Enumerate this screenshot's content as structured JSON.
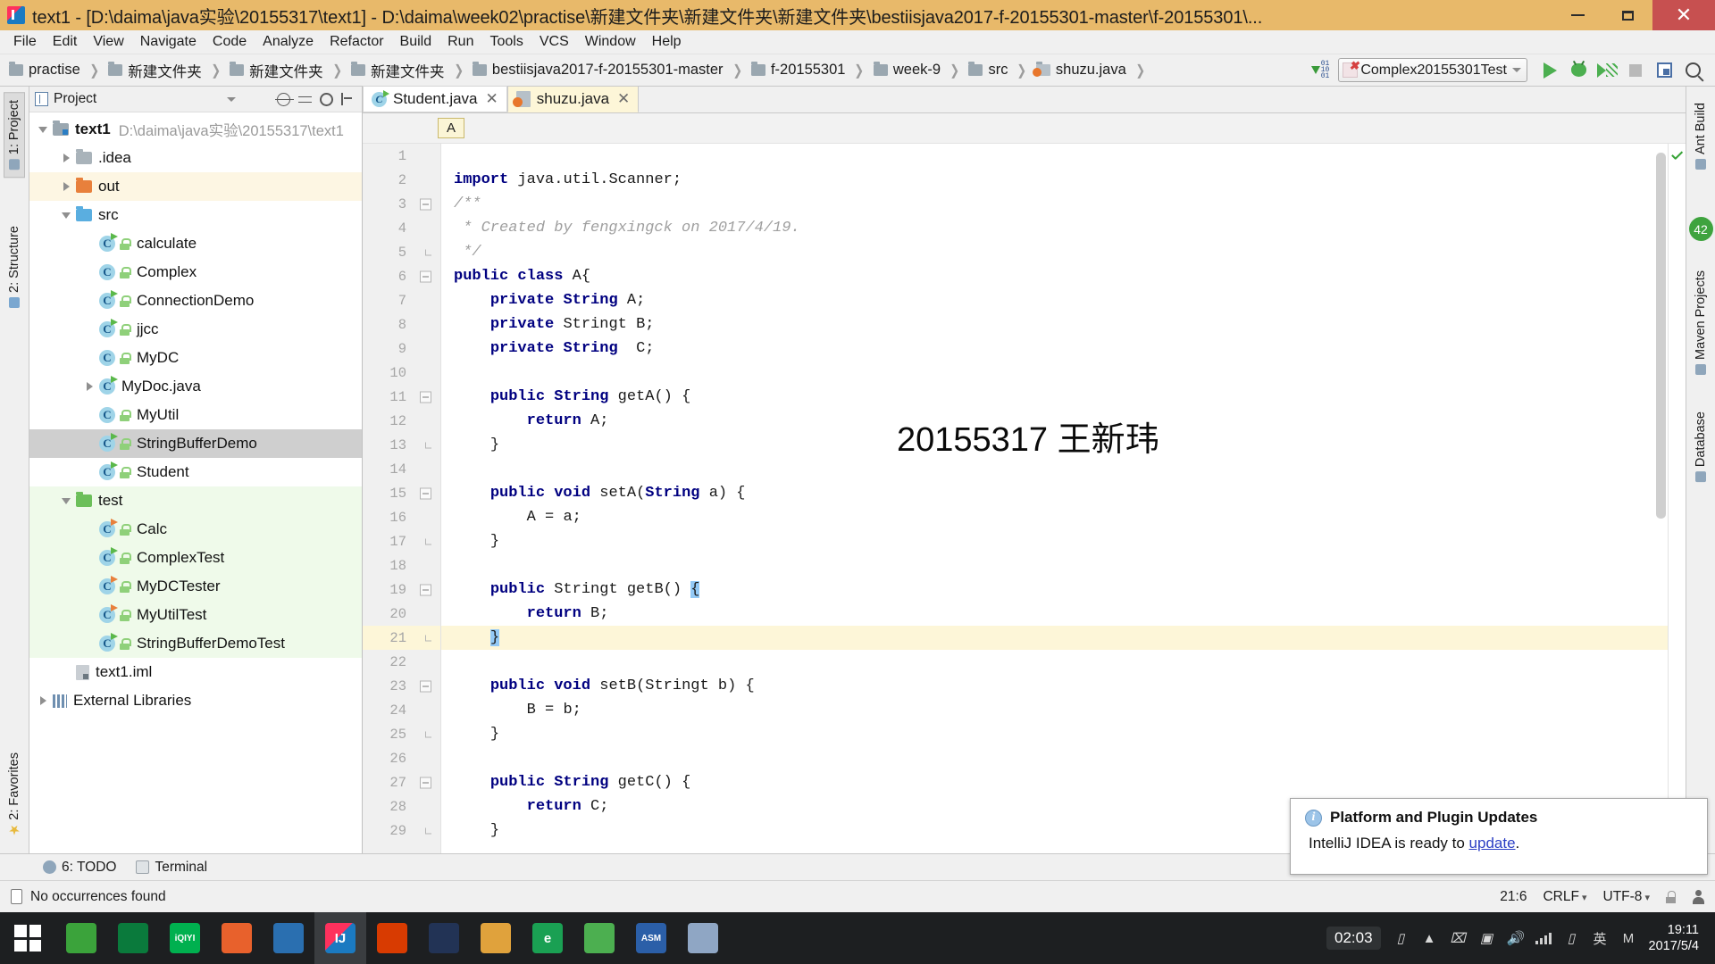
{
  "window": {
    "title": "text1 - [D:\\daima\\java实验\\20155317\\text1] - D:\\daima\\week02\\practise\\新建文件夹\\新建文件夹\\新建文件夹\\bestiisjava2017-f-20155301-master\\f-20155301\\...",
    "minimize_label": "Minimize",
    "maximize_label": "Maximize",
    "close_label": "✕"
  },
  "menu": [
    {
      "label": "File"
    },
    {
      "label": "Edit"
    },
    {
      "label": "View"
    },
    {
      "label": "Navigate"
    },
    {
      "label": "Code"
    },
    {
      "label": "Analyze"
    },
    {
      "label": "Refactor"
    },
    {
      "label": "Build"
    },
    {
      "label": "Run"
    },
    {
      "label": "Tools"
    },
    {
      "label": "VCS"
    },
    {
      "label": "Window"
    },
    {
      "label": "Help"
    }
  ],
  "navbar": {
    "breadcrumbs": [
      {
        "label": "practise",
        "kind": "folder"
      },
      {
        "label": "新建文件夹",
        "kind": "folder"
      },
      {
        "label": "新建文件夹",
        "kind": "folder"
      },
      {
        "label": "新建文件夹",
        "kind": "folder"
      },
      {
        "label": "bestiisjava2017-f-20155301-master",
        "kind": "folder"
      },
      {
        "label": "f-20155301",
        "kind": "folder"
      },
      {
        "label": "week-9",
        "kind": "folder"
      },
      {
        "label": "src",
        "kind": "folder"
      },
      {
        "label": "shuzu.java",
        "kind": "java"
      }
    ],
    "run_config": "Complex20155301Test",
    "buttons": [
      "run",
      "debug",
      "coverage",
      "stop",
      "layout",
      "search"
    ]
  },
  "left_strip": [
    {
      "label": "1: Project",
      "icon": "project-icon",
      "active": true
    },
    {
      "label": "2: Structure",
      "icon": "structure-icon",
      "active": false
    },
    {
      "label": "2: Favorites",
      "icon": "favorites-icon",
      "active": false
    }
  ],
  "right_strip": [
    {
      "label": "Ant Build",
      "icon": "ant-icon"
    },
    {
      "label": "Maven Projects",
      "icon": "maven-icon"
    },
    {
      "label": "Database",
      "icon": "database-icon"
    }
  ],
  "project": {
    "header_title": "Project",
    "actions": [
      "target-icon",
      "collapse-all-icon",
      "gear-icon",
      "hide-icon"
    ],
    "tree": [
      {
        "label": "text1",
        "path": "D:\\daima\\java实验\\20155317\\text1",
        "icon": "module-folder-icon",
        "indent": 0,
        "twisty": "down",
        "bold": true,
        "bg": "none"
      },
      {
        "label": ".idea",
        "icon": "folder-grey-icon",
        "indent": 1,
        "twisty": "right",
        "bg": "none"
      },
      {
        "label": "out",
        "icon": "folder-orange-icon",
        "indent": 1,
        "twisty": "right",
        "bg": "out"
      },
      {
        "label": "src",
        "icon": "folder-blue-icon",
        "indent": 1,
        "twisty": "down",
        "bg": "none"
      },
      {
        "label": "calculate",
        "icon": "class-runnable-icon",
        "indent": 2,
        "twisty": "none",
        "bg": "none"
      },
      {
        "label": "Complex",
        "icon": "class-icon",
        "indent": 2,
        "twisty": "none",
        "bg": "none"
      },
      {
        "label": "ConnectionDemo",
        "icon": "class-runnable-icon",
        "indent": 2,
        "twisty": "none",
        "bg": "none"
      },
      {
        "label": "jjcc",
        "icon": "class-runnable-icon",
        "indent": 2,
        "twisty": "none",
        "bg": "none"
      },
      {
        "label": "MyDC",
        "icon": "class-icon",
        "indent": 2,
        "twisty": "none",
        "bg": "none"
      },
      {
        "label": "MyDoc.java",
        "icon": "class-runnable-icon",
        "indent": 2,
        "twisty": "right",
        "bg": "none",
        "nolock": true
      },
      {
        "label": "MyUtil",
        "icon": "class-icon",
        "indent": 2,
        "twisty": "none",
        "bg": "none"
      },
      {
        "label": "StringBufferDemo",
        "icon": "class-runnable-icon",
        "indent": 2,
        "twisty": "none",
        "bg": "selected"
      },
      {
        "label": "Student",
        "icon": "class-runnable-icon",
        "indent": 2,
        "twisty": "none",
        "bg": "none"
      },
      {
        "label": "test",
        "icon": "folder-green-icon",
        "indent": 1,
        "twisty": "down",
        "bg": "test"
      },
      {
        "label": "Calc",
        "icon": "class-runnable-orange-icon",
        "indent": 2,
        "twisty": "none",
        "bg": "test"
      },
      {
        "label": "ComplexTest",
        "icon": "class-runnable-icon",
        "indent": 2,
        "twisty": "none",
        "bg": "test"
      },
      {
        "label": "MyDCTester",
        "icon": "class-runnable-orange-icon",
        "indent": 2,
        "twisty": "none",
        "bg": "test"
      },
      {
        "label": "MyUtilTest",
        "icon": "class-runnable-orange-icon",
        "indent": 2,
        "twisty": "none",
        "bg": "test"
      },
      {
        "label": "StringBufferDemoTest",
        "icon": "class-runnable-icon",
        "indent": 2,
        "twisty": "none",
        "bg": "test"
      },
      {
        "label": "text1.iml",
        "icon": "iml-file-icon",
        "indent": 1,
        "twisty": "none",
        "bg": "none"
      },
      {
        "label": "External Libraries",
        "icon": "library-icon",
        "indent": 0,
        "twisty": "right",
        "bg": "none"
      }
    ]
  },
  "editor": {
    "tabs": [
      {
        "label": "Student.java",
        "icon": "class-file-icon",
        "active": false,
        "closable": true
      },
      {
        "label": "shuzu.java",
        "icon": "java-file-icon",
        "active": true,
        "closable": true
      }
    ],
    "breadcrumb_chip": "A",
    "watermark": "20155317 王新玮",
    "lines": [
      {
        "n": 1,
        "text": "",
        "fold": "none"
      },
      {
        "n": 2,
        "text": "import java.util.Scanner;",
        "fold": "none",
        "kw": "import"
      },
      {
        "n": 3,
        "text": "/**",
        "fold": "open",
        "style": "comment"
      },
      {
        "n": 4,
        "text": " * Created by fengxingck on 2017/4/19.",
        "fold": "none",
        "style": "comment"
      },
      {
        "n": 5,
        "text": " */",
        "fold": "end",
        "style": "comment"
      },
      {
        "n": 6,
        "text": "public class A{",
        "fold": "open",
        "kw": "public class"
      },
      {
        "n": 7,
        "text": "    private String A;",
        "fold": "none",
        "kw": "private"
      },
      {
        "n": 8,
        "text": "    private Stringt B;",
        "fold": "none",
        "kw": "private"
      },
      {
        "n": 9,
        "text": "    private String  C;",
        "fold": "none",
        "kw": "private"
      },
      {
        "n": 10,
        "text": "",
        "fold": "none"
      },
      {
        "n": 11,
        "text": "    public String getA() {",
        "fold": "open",
        "kw": "public"
      },
      {
        "n": 12,
        "text": "        return A;",
        "fold": "none",
        "kw": "return"
      },
      {
        "n": 13,
        "text": "    }",
        "fold": "end"
      },
      {
        "n": 14,
        "text": "",
        "fold": "none"
      },
      {
        "n": 15,
        "text": "    public void setA(String a) {",
        "fold": "open",
        "kw": "public void"
      },
      {
        "n": 16,
        "text": "        A = a;",
        "fold": "none"
      },
      {
        "n": 17,
        "text": "    }",
        "fold": "end"
      },
      {
        "n": 18,
        "text": "",
        "fold": "none"
      },
      {
        "n": 19,
        "text": "    public Stringt getB() {",
        "fold": "open",
        "kw": "public",
        "brace_hl": true
      },
      {
        "n": 20,
        "text": "        return B;",
        "fold": "none",
        "kw": "return"
      },
      {
        "n": 21,
        "text": "    }",
        "fold": "end",
        "current": true,
        "brace_hl": true
      },
      {
        "n": 22,
        "text": "",
        "fold": "none"
      },
      {
        "n": 23,
        "text": "    public void setB(Stringt b) {",
        "fold": "open",
        "kw": "public void"
      },
      {
        "n": 24,
        "text": "        B = b;",
        "fold": "none"
      },
      {
        "n": 25,
        "text": "    }",
        "fold": "end"
      },
      {
        "n": 26,
        "text": "",
        "fold": "none"
      },
      {
        "n": 27,
        "text": "    public String getC() {",
        "fold": "open",
        "kw": "public"
      },
      {
        "n": 28,
        "text": "        return C;",
        "fold": "none",
        "kw": "return"
      },
      {
        "n": 29,
        "text": "    }",
        "fold": "end"
      }
    ]
  },
  "bottom_tools": [
    {
      "label": "6: TODO",
      "icon": "todo-icon"
    },
    {
      "label": "Terminal",
      "icon": "terminal-icon"
    }
  ],
  "status_bar": {
    "message": "No occurrences found",
    "caret": "21:6",
    "line_separator": "CRLF",
    "encoding": "UTF-8",
    "lock_icon": "lock-icon",
    "person_icon": "person-icon"
  },
  "notification": {
    "title": "Platform and Plugin Updates",
    "body_prefix": "IntelliJ IDEA is ready to ",
    "link": "update",
    "body_suffix": ".",
    "icon": "info-icon"
  },
  "taskbar": {
    "start_label": "Start",
    "apps": [
      {
        "name": "file-explorer",
        "color": "#3ba33b",
        "glyph": ""
      },
      {
        "name": "store",
        "color": "#0a7a3c",
        "glyph": ""
      },
      {
        "name": "iqiyi",
        "color": "#00b04f",
        "glyph": "iQIYI"
      },
      {
        "name": "browser",
        "color": "#e8612c",
        "glyph": ""
      },
      {
        "name": "media",
        "color": "#2a6fb0",
        "glyph": ""
      },
      {
        "name": "intellij-idea",
        "color": "#f0f0f0",
        "glyph": "IJ"
      },
      {
        "name": "office",
        "color": "#d83b01",
        "glyph": ""
      },
      {
        "name": "game",
        "color": "#223355",
        "glyph": ""
      },
      {
        "name": "folder",
        "color": "#e0a23c",
        "glyph": ""
      },
      {
        "name": "edge",
        "color": "#1aa053",
        "glyph": "e"
      },
      {
        "name": "wechat",
        "color": "#4caf50",
        "glyph": ""
      },
      {
        "name": "tool",
        "color": "#2b5fa8",
        "glyph": "ASM"
      },
      {
        "name": "notepad",
        "color": "#8fa6c4",
        "glyph": ""
      }
    ],
    "timer": "02:03",
    "ime": "英",
    "tray_m": "M",
    "time": "19:11",
    "date": "2017/5/4"
  }
}
